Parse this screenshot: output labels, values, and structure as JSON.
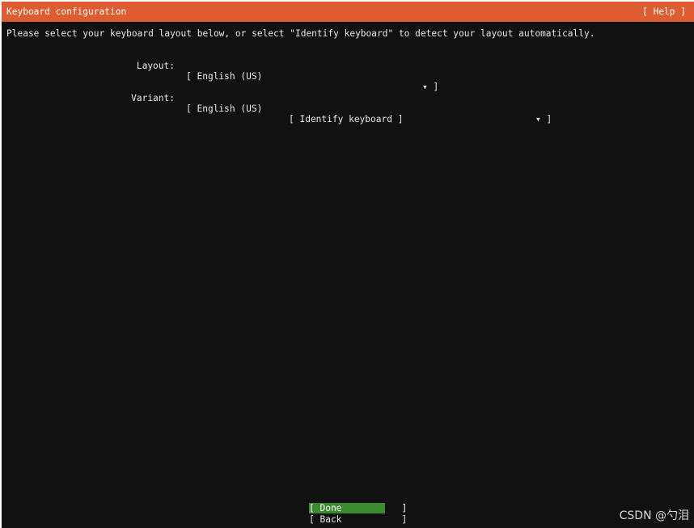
{
  "header": {
    "title": "Keyboard configuration",
    "help": "[ Help ]"
  },
  "instructions": "Please select your keyboard layout below, or select \"Identify keyboard\" to detect your layout automatically.",
  "layout": {
    "label": "Layout:",
    "open": "[ ",
    "value": "English (US)",
    "arrow": "▾ ]"
  },
  "variant": {
    "label": "Variant:",
    "open": "[ ",
    "value": "English (US)",
    "arrow": "▾ ]"
  },
  "identify_button": "[ Identify keyboard ]",
  "footer": {
    "done": "[ Done           ]",
    "back": "[ Back           ]"
  },
  "watermark": "CSDN @勺泪",
  "colors": {
    "title_bar": "#dd5d30",
    "background": "#111111",
    "selected_button": "#3c8a30"
  }
}
